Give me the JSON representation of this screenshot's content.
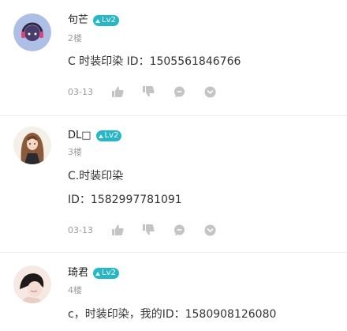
{
  "comments": [
    {
      "username": "句芒",
      "level": "Lv2",
      "floor": "2楼",
      "lines": [
        "C 时装印染 ID：1505561846766"
      ],
      "date": "03-13"
    },
    {
      "username": "DL□",
      "level": "Lv2",
      "floor": "3楼",
      "lines": [
        "C.时装印染",
        "ID：1582997781091"
      ],
      "date": "03-13"
    },
    {
      "username": "琦君",
      "level": "Lv2",
      "floor": "4楼",
      "lines": [
        "c，时装印染，我的ID：1580908126080"
      ]
    }
  ],
  "icons": {
    "like": "thumbs-up-icon",
    "dislike": "thumbs-down-icon",
    "reply": "speech-bubble-icon",
    "more": "chevron-down-circle-icon"
  },
  "colors": {
    "level_badge": "#27b7c6",
    "icon_gray": "#c4c4c4",
    "meta_text": "#9b9b9b"
  }
}
